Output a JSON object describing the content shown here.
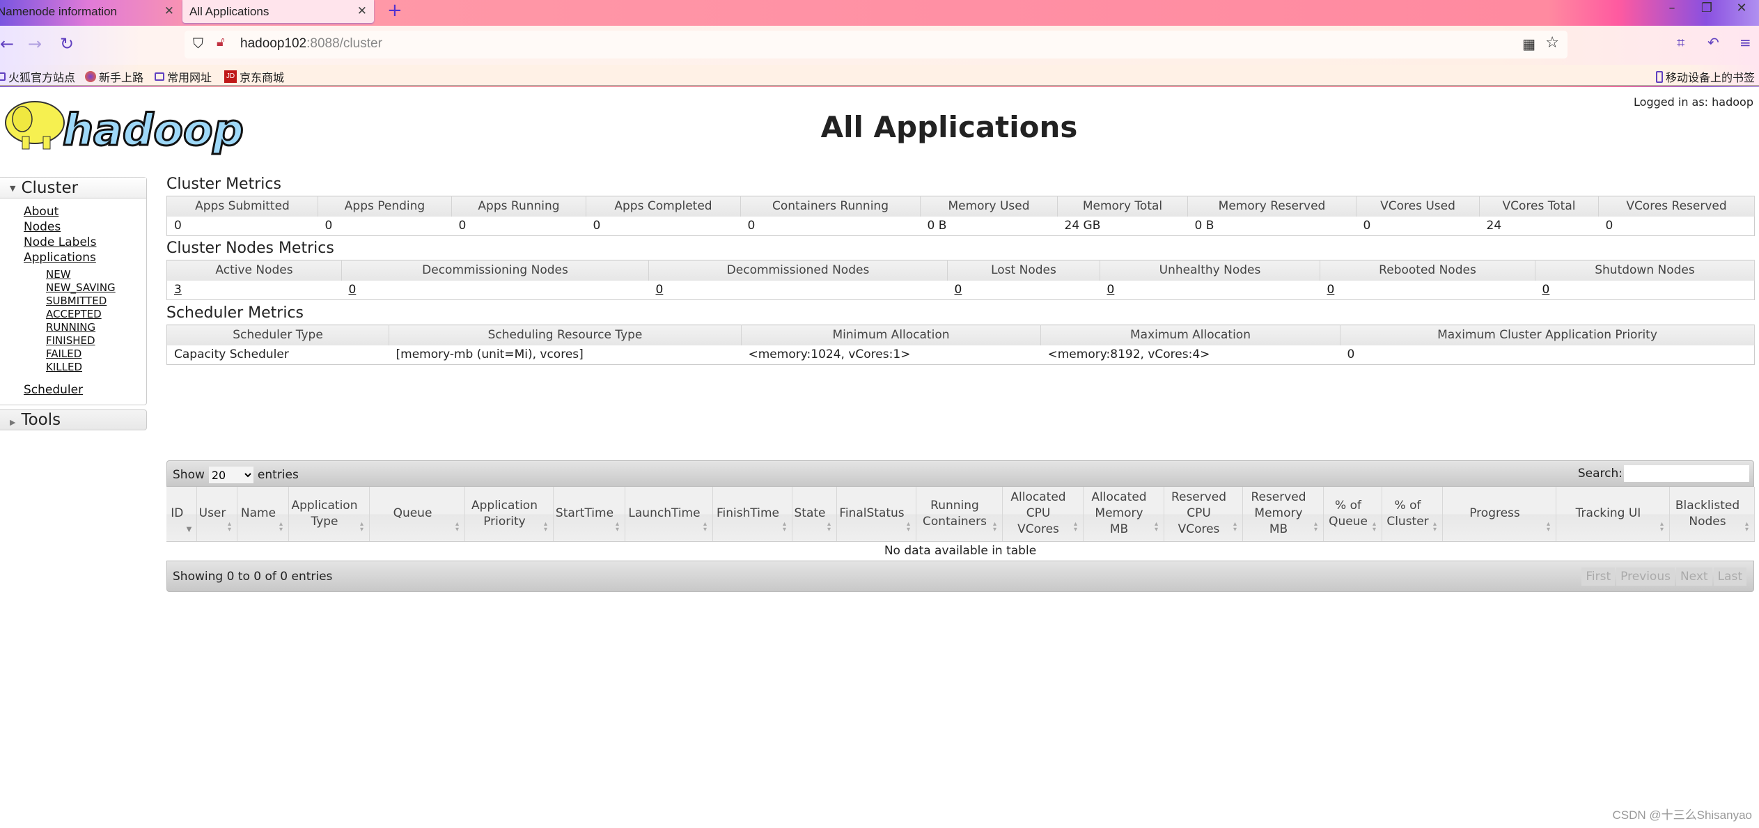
{
  "browser": {
    "tabs": [
      {
        "label": "Namenode information"
      },
      {
        "label": "All Applications"
      }
    ],
    "url_host": "hadoop102",
    "url_rest": ":8088/cluster",
    "bookmarks": [
      "火狐官方站点",
      "新手上路",
      "常用网址",
      "京东商城"
    ],
    "mobile_bookmarks": "移动设备上的书签"
  },
  "header": {
    "logo": "hadoop",
    "title": "All Applications",
    "logged_in": "Logged in as: hadoop"
  },
  "sidebar": {
    "cluster": "Cluster",
    "links": [
      "About",
      "Nodes",
      "Node Labels",
      "Applications"
    ],
    "app_states": [
      "NEW",
      "NEW_SAVING",
      "SUBMITTED",
      "ACCEPTED",
      "RUNNING",
      "FINISHED",
      "FAILED",
      "KILLED"
    ],
    "scheduler": "Scheduler",
    "tools": "Tools"
  },
  "cluster_metrics": {
    "title": "Cluster Metrics",
    "headers": [
      "Apps Submitted",
      "Apps Pending",
      "Apps Running",
      "Apps Completed",
      "Containers Running",
      "Memory Used",
      "Memory Total",
      "Memory Reserved",
      "VCores Used",
      "VCores Total",
      "VCores Reserved"
    ],
    "values": [
      "0",
      "0",
      "0",
      "0",
      "0",
      "0 B",
      "24 GB",
      "0 B",
      "0",
      "24",
      "0"
    ]
  },
  "nodes_metrics": {
    "title": "Cluster Nodes Metrics",
    "headers": [
      "Active Nodes",
      "Decommissioning Nodes",
      "Decommissioned Nodes",
      "Lost Nodes",
      "Unhealthy Nodes",
      "Rebooted Nodes",
      "Shutdown Nodes"
    ],
    "values": [
      "3",
      "0",
      "0",
      "0",
      "0",
      "0",
      "0"
    ]
  },
  "scheduler_metrics": {
    "title": "Scheduler Metrics",
    "headers": [
      "Scheduler Type",
      "Scheduling Resource Type",
      "Minimum Allocation",
      "Maximum Allocation",
      "Maximum Cluster Application Priority"
    ],
    "values": [
      "Capacity Scheduler",
      "[memory-mb (unit=Mi), vcores]",
      "<memory:1024, vCores:1>",
      "<memory:8192, vCores:4>",
      "0"
    ]
  },
  "apps": {
    "show": "Show",
    "page_size": "20",
    "entries": "entries",
    "search_label": "Search:",
    "search_value": "",
    "columns": [
      "ID",
      "User",
      "Name",
      "Application Type",
      "Queue",
      "Application Priority",
      "StartTime",
      "LaunchTime",
      "FinishTime",
      "State",
      "FinalStatus",
      "Running Containers",
      "Allocated CPU VCores",
      "Allocated Memory MB",
      "Reserved CPU VCores",
      "Reserved Memory MB",
      "% of Queue",
      "% of Cluster",
      "Progress",
      "Tracking UI",
      "Blacklisted Nodes"
    ],
    "empty": "No data available in table",
    "info": "Showing 0 to 0 of 0 entries",
    "pager": [
      "First",
      "Previous",
      "Next",
      "Last"
    ]
  },
  "watermark": "CSDN @十三么Shisanyao"
}
